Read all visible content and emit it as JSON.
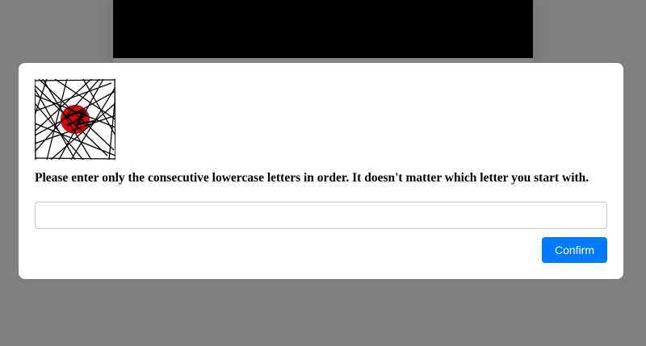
{
  "captcha": {
    "image_alt": "captcha-image",
    "accent_color": "#e00000"
  },
  "prompt": {
    "instruction": "Please enter only the consecutive lowercase letters in order. It doesn't matter which letter you start with."
  },
  "answer": {
    "value": "",
    "placeholder": ""
  },
  "actions": {
    "confirm_label": "Confirm",
    "confirm_color": "#007bff"
  }
}
